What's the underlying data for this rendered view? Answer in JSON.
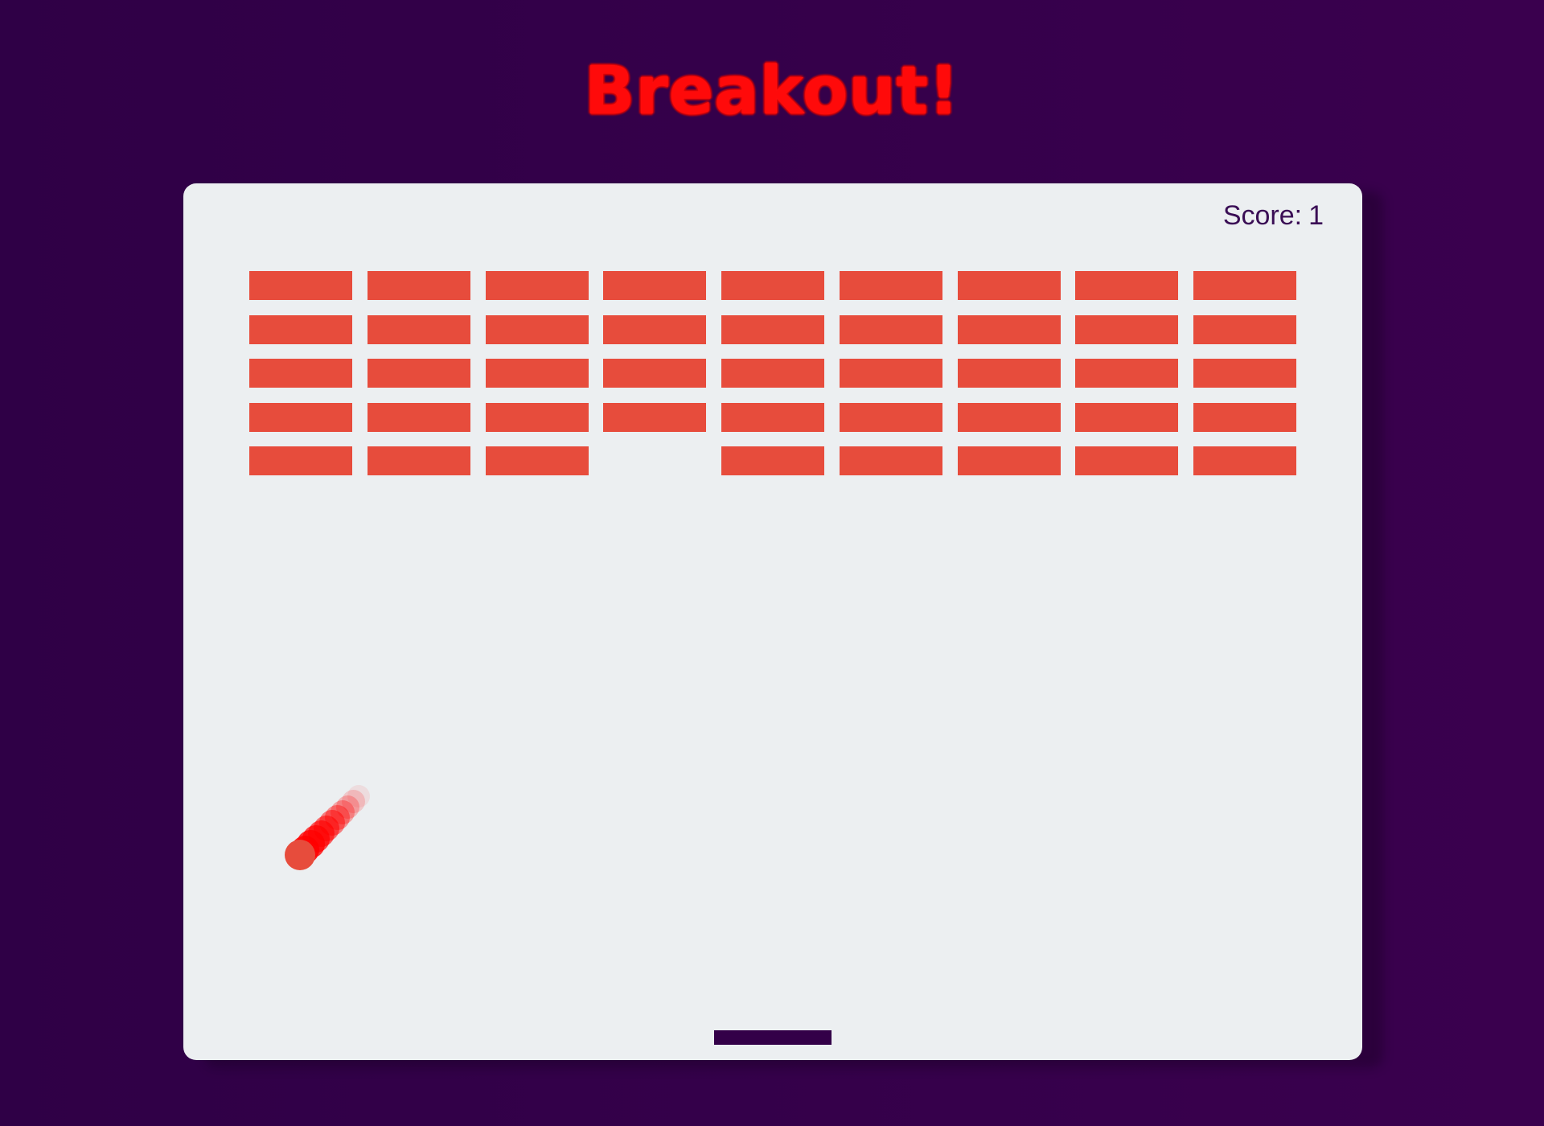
{
  "app": {
    "title": "Breakout!"
  },
  "hud": {
    "score_label": "Score:",
    "score_value": "1"
  },
  "bricks": {
    "rows": 5,
    "columns": 9,
    "broken": [
      [
        4,
        3
      ]
    ]
  },
  "colors": {
    "background": "#330048",
    "board": "#eceff1",
    "brick": "#e74c3c",
    "ball": "#e74c3c",
    "ball_trail": "#ff0000",
    "paddle": "#330048",
    "title": "#ff0a0a",
    "score_text": "#3a0e55"
  }
}
